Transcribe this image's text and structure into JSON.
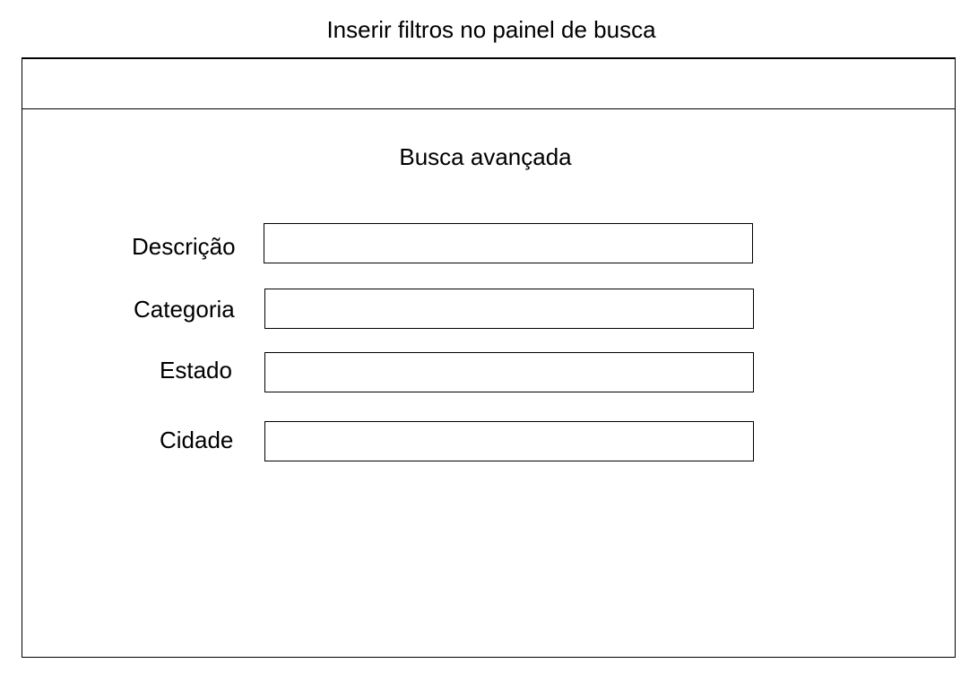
{
  "page": {
    "caption": "Inserir filtros no painel de busca"
  },
  "panel": {
    "title": "Busca avançada"
  },
  "fields": {
    "descricao": {
      "label": "Descrição",
      "value": ""
    },
    "categoria": {
      "label": "Categoria",
      "value": ""
    },
    "estado": {
      "label": "Estado",
      "value": ""
    },
    "cidade": {
      "label": "Cidade",
      "value": ""
    }
  }
}
